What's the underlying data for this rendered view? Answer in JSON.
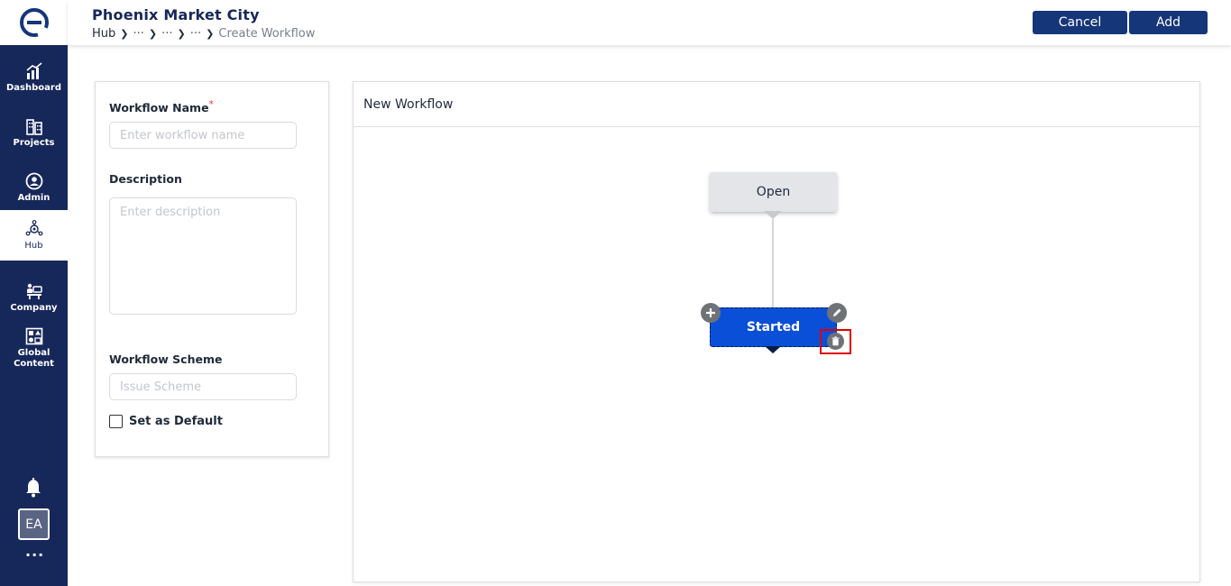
{
  "app": {
    "title": "Phoenix Market City"
  },
  "breadcrumb": {
    "items": [
      "Hub",
      "···",
      "···",
      "···",
      "Create Workflow"
    ]
  },
  "header": {
    "cancel_label": "Cancel",
    "add_label": "Add"
  },
  "sidebar": {
    "items": [
      {
        "label": "Dashboard",
        "icon": "chart-icon"
      },
      {
        "label": "Projects",
        "icon": "building-icon"
      },
      {
        "label": "Admin",
        "icon": "admin-icon"
      },
      {
        "label": "Hub",
        "icon": "hub-icon",
        "active": true
      },
      {
        "label": "Company",
        "icon": "company-icon"
      },
      {
        "label": "Global Content",
        "icon": "global-content-icon"
      }
    ],
    "avatar_initials": "EA",
    "more_label": "···"
  },
  "form": {
    "workflow_name_label": "Workflow Name",
    "required_mark": "*",
    "workflow_name_placeholder": "Enter workflow name",
    "description_label": "Description",
    "description_placeholder": "Enter description",
    "workflow_scheme_label": "Workflow Scheme",
    "workflow_scheme_placeholder": "Issue Scheme",
    "default_label": "Set as Default",
    "default_checked": false
  },
  "canvas": {
    "title": "New Workflow",
    "nodes": [
      {
        "label": "Open",
        "selected": false
      },
      {
        "label": "Started",
        "selected": true
      }
    ]
  },
  "colors": {
    "sidebar": "#16275a",
    "primary_button": "#16367a",
    "selected_node": "#0a4fd8",
    "highlight": "#e00000"
  }
}
